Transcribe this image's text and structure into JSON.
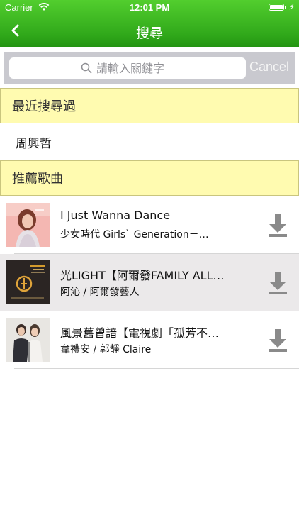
{
  "status_bar": {
    "carrier": "Carrier",
    "time": "12:01 PM"
  },
  "nav": {
    "title": "搜尋",
    "back_icon": "chevron-left-icon"
  },
  "search": {
    "placeholder": "請輸入關鍵字",
    "cancel_label": "Cancel"
  },
  "recent": {
    "header": "最近搜尋過",
    "items": [
      "周興哲"
    ]
  },
  "recommended": {
    "header": "推薦歌曲",
    "songs": [
      {
        "title": "I Just Wanna Dance",
        "artist": "少女時代 Girls` Generation－…"
      },
      {
        "title": "光LIGHT【阿爾發FAMILY ALL…",
        "artist": "阿沁 / 阿爾發藝人"
      },
      {
        "title": "風景舊曾諳【電視劇「孤芳不…",
        "artist": "韋禮安 / 郭靜 Claire"
      }
    ]
  },
  "colors": {
    "nav_green": "#30a81a",
    "section_bg": "#fffbb0",
    "download_icon": "#8a8a8a"
  }
}
